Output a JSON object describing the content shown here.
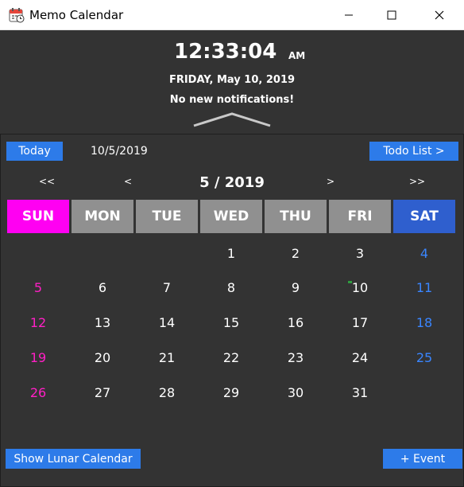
{
  "window": {
    "title": "Memo Calendar",
    "icon": "calendar-icon",
    "minimize_icon": "minimize-icon",
    "maximize_icon": "maximize-icon",
    "close_icon": "close-icon"
  },
  "clock": {
    "time": "12:33:04",
    "ampm": "AM",
    "date_full": "FRIDAY, May 10, 2019",
    "notification": "No new notifications!",
    "collapse_icon": "chevron-up-icon"
  },
  "toolbar": {
    "today_label": "Today",
    "selected_date": "10/5/2019",
    "todo_label": "Todo List >"
  },
  "navigation": {
    "prev_year": "<<",
    "prev_month": "<",
    "month_title": "5 / 2019",
    "next_month": ">",
    "next_year": ">>"
  },
  "weekdays": [
    "SUN",
    "MON",
    "TUE",
    "WED",
    "THU",
    "FRI",
    "SAT"
  ],
  "weekday_colors": [
    "#ff00f2",
    "#909090",
    "#909090",
    "#909090",
    "#909090",
    "#909090",
    "#2f5fce"
  ],
  "weeks": [
    [
      "",
      "",
      "",
      "1",
      "2",
      "3",
      "4"
    ],
    [
      "5",
      "6",
      "7",
      "8",
      "9",
      "10",
      "11"
    ],
    [
      "12",
      "13",
      "14",
      "15",
      "16",
      "17",
      "18"
    ],
    [
      "19",
      "20",
      "21",
      "22",
      "23",
      "24",
      "25"
    ],
    [
      "26",
      "27",
      "28",
      "29",
      "30",
      "31",
      ""
    ]
  ],
  "memo_days": [
    "10"
  ],
  "colors": {
    "background": "#333333",
    "accent": "#2d7be9",
    "sunday_text": "#ff1fc5",
    "saturday_text": "#3a86ff",
    "memo_marker": "#2e9d3f"
  },
  "footer": {
    "lunar_label": "Show Lunar Calendar",
    "event_label": "+ Event"
  }
}
